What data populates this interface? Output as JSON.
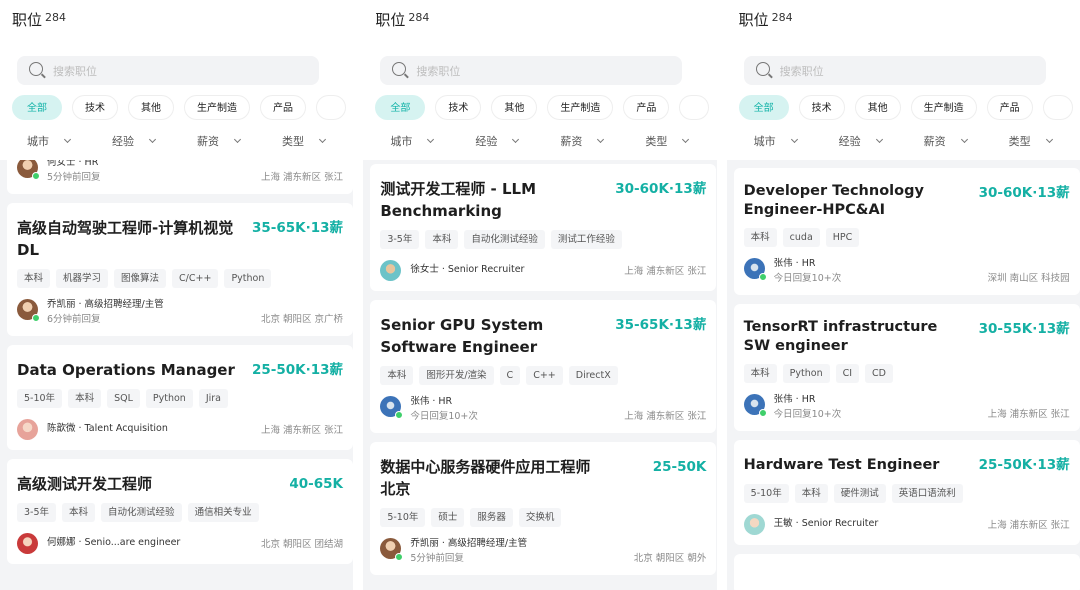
{
  "screens": [
    {
      "header": {
        "title": "职位",
        "count": "284"
      },
      "search": {
        "placeholder": "搜索职位"
      },
      "chips": [
        "全部",
        "技术",
        "其他",
        "生产制造",
        "产品",
        ""
      ],
      "filters": [
        "城市",
        "经验",
        "薪资",
        "类型"
      ],
      "partial_top": {
        "recruiter_name": "何女士 · HR",
        "activity": "5分钟前回复",
        "location": "上海  浦东新区  张江"
      },
      "jobs": [
        {
          "title": "高级自动驾驶工程师-计算机视觉DL",
          "salary": "35-65K·13薪",
          "tags": [
            "本科",
            "机器学习",
            "图像算法",
            "C/C++",
            "Python"
          ],
          "recruiter_name": "乔凯丽 · 高级招聘经理/主管",
          "activity": "6分钟前回复",
          "location": "北京  朝阳区  京广桥",
          "avatar": "brown",
          "online": true
        },
        {
          "title": "Data Operations Manager",
          "salary": "25-50K·13薪",
          "tags": [
            "5-10年",
            "本科",
            "SQL",
            "Python",
            "Jira"
          ],
          "recruiter_name": "陈歆微 · Talent Acquisition",
          "activity": "",
          "location": "上海  浦东新区  张江",
          "avatar": "pink",
          "online": false
        },
        {
          "title": "高级测试开发工程师",
          "salary": "40-65K",
          "tags": [
            "3-5年",
            "本科",
            "自动化测试经验",
            "通信相关专业"
          ],
          "recruiter_name": "何娜娜 · Senio...are engineer",
          "activity": "",
          "location": "北京  朝阳区  团结湖",
          "avatar": "red",
          "online": false
        }
      ]
    },
    {
      "header": {
        "title": "职位",
        "count": "284"
      },
      "search": {
        "placeholder": "搜索职位"
      },
      "chips": [
        "全部",
        "技术",
        "其他",
        "生产制造",
        "产品",
        ""
      ],
      "filters": [
        "城市",
        "经验",
        "薪资",
        "类型"
      ],
      "jobs": [
        {
          "title": "测试开发工程师 - LLM Benchmarking",
          "salary": "30-60K·13薪",
          "tags": [
            "3-5年",
            "本科",
            "自动化测试经验",
            "测试工作经验"
          ],
          "recruiter_name": "徐女士 · Senior Recruiter",
          "activity": "",
          "location": "上海  浦东新区  张江",
          "avatar": "teal",
          "online": false
        },
        {
          "title": "Senior GPU System Software Engineer",
          "salary": "35-65K·13薪",
          "tags": [
            "本科",
            "图形开发/渲染",
            "C",
            "C++",
            "DirectX"
          ],
          "recruiter_name": "张伟 · HR",
          "activity": "今日回复10+次",
          "location": "上海  浦东新区  张江",
          "avatar": "blue",
          "online": true
        },
        {
          "title": "数据中心服务器硬件应用工程师 北京",
          "salary": "25-50K",
          "tags": [
            "5-10年",
            "硕士",
            "服务器",
            "交换机"
          ],
          "recruiter_name": "乔凯丽 · 高级招聘经理/主管",
          "activity": "5分钟前回复",
          "location": "北京  朝阳区  朝外",
          "avatar": "brown",
          "online": true
        }
      ]
    },
    {
      "header": {
        "title": "职位",
        "count": "284"
      },
      "search": {
        "placeholder": "搜索职位"
      },
      "chips": [
        "全部",
        "技术",
        "其他",
        "生产制造",
        "产品",
        ""
      ],
      "filters": [
        "城市",
        "经验",
        "薪资",
        "类型"
      ],
      "jobs": [
        {
          "title": "Developer Technology Engineer-HPC&AI",
          "salary": "30-60K·13薪",
          "tags": [
            "本科",
            "cuda",
            "HPC"
          ],
          "recruiter_name": "张伟 · HR",
          "activity": "今日回复10+次",
          "location": "深圳  南山区  科技园",
          "avatar": "blue",
          "online": true
        },
        {
          "title": "TensorRT infrastructure SW engineer",
          "salary": "30-55K·13薪",
          "tags": [
            "本科",
            "Python",
            "CI",
            "CD"
          ],
          "recruiter_name": "张伟 · HR",
          "activity": "今日回复10+次",
          "location": "上海  浦东新区  张江",
          "avatar": "blue",
          "online": true
        },
        {
          "title": "Hardware Test Engineer",
          "salary": "25-50K·13薪",
          "tags": [
            "5-10年",
            "本科",
            "硬件测试",
            "英语口语流利"
          ],
          "recruiter_name": "王敏 · Senior Recruiter",
          "activity": "",
          "location": "上海  浦东新区  张江",
          "avatar": "mint",
          "online": false
        }
      ]
    }
  ]
}
